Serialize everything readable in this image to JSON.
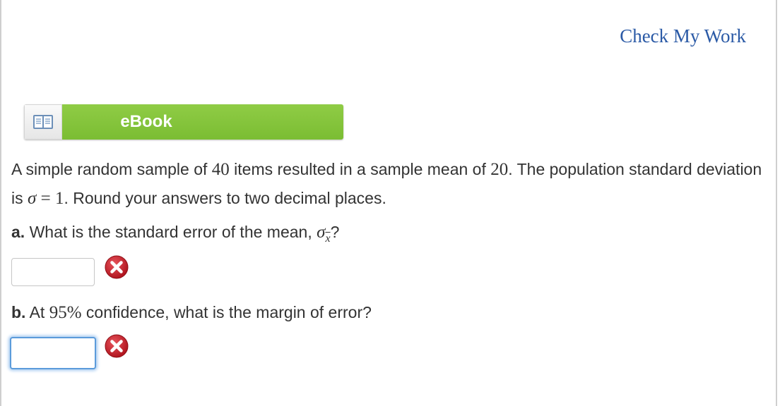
{
  "header": {
    "check_my_work": "Check My Work"
  },
  "ebook": {
    "label": "eBook",
    "icon": "book-icon"
  },
  "question": {
    "text_1": "A simple random sample of ",
    "n": "40",
    "text_2": " items resulted in a sample mean of ",
    "mean": "20",
    "text_3": ". The population standard deviation is ",
    "sigma": "σ",
    "equals": " = 1",
    "text_4": ". Round your answers to two decimal places."
  },
  "part_a": {
    "letter": "a.",
    "text": " What is the standard error of the mean, ",
    "sigma": "σ",
    "subscript": "x",
    "end": "?",
    "answer_value": "",
    "status_icon": "incorrect-x-icon"
  },
  "part_b": {
    "letter": "b.",
    "text_1": " At ",
    "percent": "95%",
    "text_2": " confidence, what is the margin of error?",
    "answer_value": "",
    "status_icon": "incorrect-x-icon"
  },
  "colors": {
    "link": "#2b5aa6",
    "ebook_green": "#84c43b",
    "error_red": "#c8212b",
    "focus_blue": "#5b9bdb"
  }
}
